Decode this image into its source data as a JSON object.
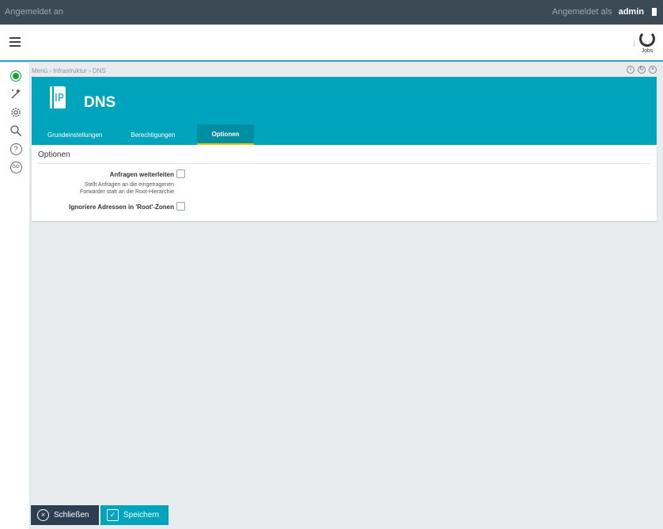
{
  "topbar": {
    "left_text": "Angemeldet an",
    "logged_in_as": "Angemeldet als",
    "username": "admin"
  },
  "header": {
    "jobs_label": "Jobs"
  },
  "rail": {
    "icons": [
      "status-icon",
      "wizard-icon",
      "settings-icon",
      "search-icon",
      "help-icon",
      "go-icon"
    ],
    "go_label": "GO",
    "help_label": "?"
  },
  "breadcrumb": {
    "text": "Menü › Infrastruktur › DNS"
  },
  "panel": {
    "icon_text": "IP",
    "title": "DNS",
    "tabs": [
      {
        "label": "Grundeinstellungen",
        "active": false
      },
      {
        "label": "Berechtigungen",
        "active": false
      },
      {
        "label": "Optionen",
        "active": true
      }
    ]
  },
  "options": {
    "section_title": "Optionen",
    "forward_label": "Anfragen weiterleiten",
    "forward_hint_1": "Stellt Anfragen an die eingetragenen",
    "forward_hint_2": "Forwarder statt an die Root-Hierarchie",
    "ignore_label": "Ignoriere Adressen in 'Root'-Zonen"
  },
  "footer": {
    "close_label": "Schließen",
    "save_label": "Speichern"
  },
  "colors": {
    "accent": "#00a5bd",
    "dark": "#2c3e50",
    "topbar": "#3c4a55",
    "tab_underline": "#f5c400",
    "status_green": "#11a830"
  }
}
